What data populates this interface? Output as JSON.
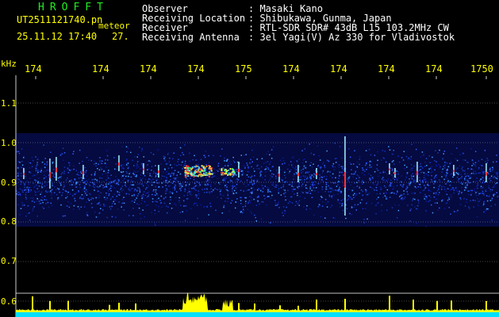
{
  "header": {
    "app_name": "HROFFT",
    "file_name": "UT2511121740.pn",
    "mode": "meteor",
    "date_time": "25.11.12 17:40",
    "count": "27.",
    "info": [
      {
        "key": "Observer",
        "value": ": Masaki Kano"
      },
      {
        "key": "Receiving Location",
        "value": ": Shibukawa, Gunma, Japan"
      },
      {
        "key": "Receiver",
        "value": ": RTL-SDR SDR# 43dB L15 103.2MHz CW"
      },
      {
        "key": "Receiving Antenna",
        "value": ": 3el Yagi(V) Az 330 for Vladivostok"
      }
    ]
  },
  "axis": {
    "unit": "kHz",
    "x_ticks": [
      "174",
      "174",
      "174",
      "174",
      "175",
      "174",
      "174",
      "174",
      "174",
      "1750"
    ],
    "y_ticks": [
      "1.1",
      "1.0",
      "0.9",
      "0.8",
      "0.7",
      "0.6"
    ]
  },
  "colors": {
    "text_header": "#ffff00",
    "app_name": "#22ee22",
    "grid": "#ffffff",
    "noise_band": "#1020a0",
    "signal_hot": "#ff3030",
    "spectrum_fill": "#ffff00",
    "baseline": "#00e0ff"
  }
}
